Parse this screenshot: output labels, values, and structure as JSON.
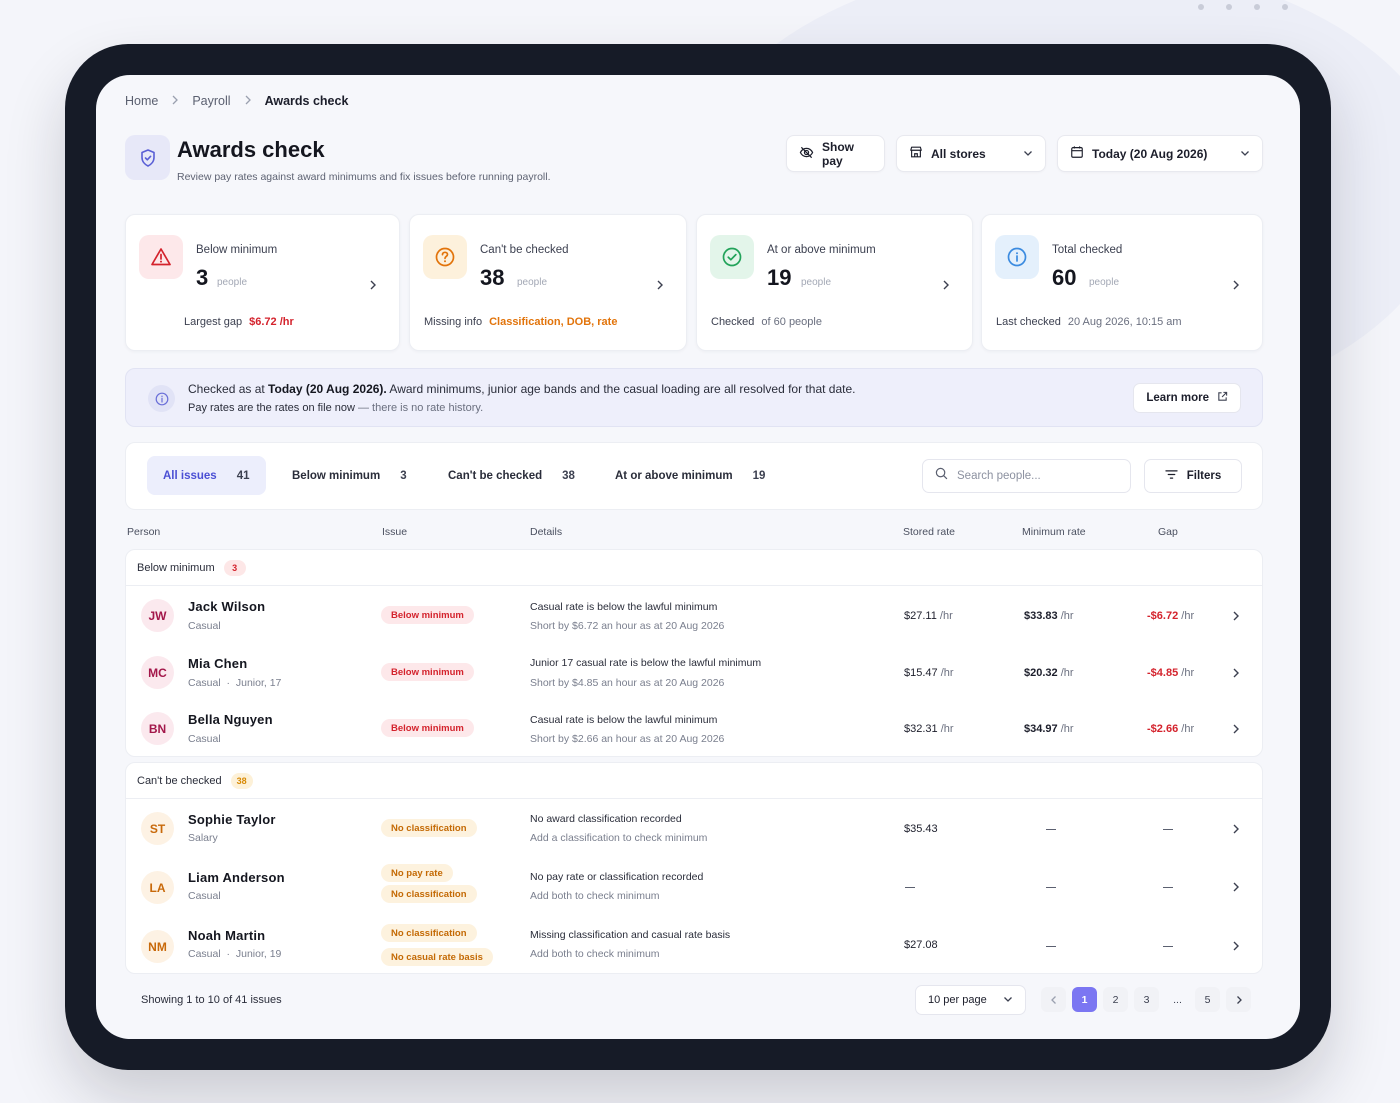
{
  "breadcrumb": [
    "Home",
    "Payroll",
    "Awards check"
  ],
  "header": {
    "title": "Awards check",
    "subtitle": "Review pay rates against award minimums and fix issues before running payroll.",
    "show_pay": "Show pay",
    "stores": "All stores",
    "date": "Today (20 Aug 2026)"
  },
  "cards": [
    {
      "label": "Below minimum",
      "value": "3",
      "unit": "people",
      "foot_label": "Largest gap",
      "foot_value": "$6.72 /hr",
      "color": "#d4232d"
    },
    {
      "label": "Can't be checked",
      "value": "38",
      "unit": "people",
      "foot_label": "Missing info",
      "foot_value": "Classification, DOB, rate",
      "color": "#e2740b"
    },
    {
      "label": "At or above minimum",
      "value": "19",
      "unit": "people",
      "foot_label": "Checked",
      "foot_value": "of 60 people",
      "color": "#22a35a"
    },
    {
      "label": "Total checked",
      "value": "60",
      "unit": "people",
      "foot_label": "Last checked",
      "foot_value": "20 Aug 2026, 10:15 am",
      "color": "#3b8be0"
    }
  ],
  "banner": {
    "pre": "Checked as at ",
    "bold": "Today (20 Aug 2026).",
    "post": " Award minimums, junior age bands and the casual loading are all resolved for that date.",
    "line2_a": "Pay rates are the rates on file now",
    "line2_b": " — there is no rate history.",
    "learn_more": "Learn more"
  },
  "tabs": [
    {
      "label": "All issues",
      "count": "41"
    },
    {
      "label": "Below minimum",
      "count": "3"
    },
    {
      "label": "Can't be checked",
      "count": "38"
    },
    {
      "label": "At or above minimum",
      "count": "19"
    }
  ],
  "search": {
    "placeholder": "Search people..."
  },
  "filters_label": "Filters",
  "columns": [
    "Person",
    "Issue",
    "Details",
    "Stored rate",
    "Minimum rate",
    "Gap"
  ],
  "groups": [
    {
      "title": "Below minimum",
      "count": "3",
      "rows": [
        {
          "initials": "JW",
          "name": "Jack Wilson",
          "meta": "Casual",
          "badges": [
            "Below minimum"
          ],
          "detail1": "Casual rate is below the lawful minimum",
          "detail2": "Short by $6.72 an hour as at 20 Aug 2026",
          "stored": "$27.11",
          "minimum": "$33.83",
          "gap": "-$6.72",
          "unit": "/hr"
        },
        {
          "initials": "MC",
          "name": "Mia Chen",
          "meta": "Casual  ·  Junior, 17",
          "badges": [
            "Below minimum"
          ],
          "detail1": "Junior 17 casual rate is below the lawful minimum",
          "detail2": "Short by $4.85 an hour as at 20 Aug 2026",
          "stored": "$15.47",
          "minimum": "$20.32",
          "gap": "-$4.85",
          "unit": "/hr"
        },
        {
          "initials": "BN",
          "name": "Bella Nguyen",
          "meta": "Casual",
          "badges": [
            "Below minimum"
          ],
          "detail1": "Casual rate is below the lawful minimum",
          "detail2": "Short by $2.66 an hour as at 20 Aug 2026",
          "stored": "$32.31",
          "minimum": "$34.97",
          "gap": "-$2.66",
          "unit": "/hr"
        }
      ]
    },
    {
      "title": "Can't be checked",
      "count": "38",
      "rows": [
        {
          "initials": "ST",
          "name": "Sophie Taylor",
          "meta": "Salary",
          "badges": [
            "No classification"
          ],
          "detail1": "No award classification recorded",
          "detail2": "Add a classification to check minimum",
          "stored": "$35.43"
        },
        {
          "initials": "LA",
          "name": "Liam Anderson",
          "meta": "Casual",
          "badges": [
            "No pay rate",
            "No classification"
          ],
          "detail1": "No pay rate or classification recorded",
          "detail2": "Add both to check minimum",
          "stored": ""
        },
        {
          "initials": "NM",
          "name": "Noah Martin",
          "meta": "Casual  ·  Junior, 19",
          "badges": [
            "No classification",
            "No casual rate basis"
          ],
          "detail1": "Missing classification and casual rate basis",
          "detail2": "Add both to check minimum",
          "stored": "$27.08"
        }
      ]
    }
  ],
  "pagination": {
    "showing": "Showing 1 to 10 of 41 issues",
    "per_page": "10 per page",
    "pages": [
      "1",
      "2",
      "3",
      "...",
      "5"
    ]
  }
}
